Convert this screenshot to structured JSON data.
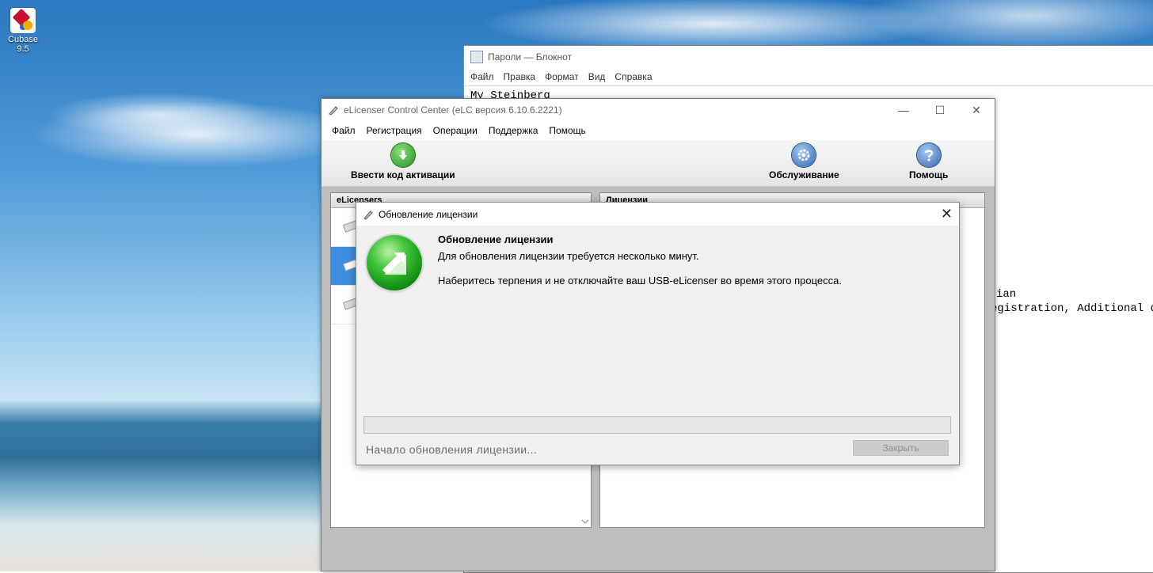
{
  "desktop": {
    "icons": [
      {
        "label": "Cubase 9.5"
      }
    ]
  },
  "notepad": {
    "title": "Пароли — Блокнот",
    "menu": [
      "Файл",
      "Правка",
      "Формат",
      "Вид",
      "Справка"
    ],
    "text_line1": "My Steinberg",
    "frag1": "ian",
    "frag2": "egistration, Additional d"
  },
  "elc": {
    "title": "eLicenser Control Center (eLC версия 6.10.6.2221)",
    "window_controls": {
      "minimize": "—",
      "maximize": "☐",
      "close": "✕"
    },
    "menu": [
      "Файл",
      "Регистрация",
      "Операции",
      "Поддержка",
      "Помощь"
    ],
    "toolbar": {
      "activate": "Ввести код активации",
      "service": "Обслуживание",
      "help": "Помощь"
    },
    "left_header": "eLicensers",
    "right_header": "Лицензии"
  },
  "dialog": {
    "title": "Обновление лицензии",
    "close_glyph": "✕",
    "heading": "Обновление лицензии",
    "line1": "Для обновления лицензии требуется несколько минут.",
    "line2": "Наберитесь терпения и не отключайте ваш USB-eLicenser во время этого процесса.",
    "progress_percent": 0,
    "status": "Начало обновления лицензии...",
    "close_button": "Закрыть"
  },
  "colors": {
    "accent_selected": "#3d8ee0",
    "progress_fill": "#06b025"
  }
}
